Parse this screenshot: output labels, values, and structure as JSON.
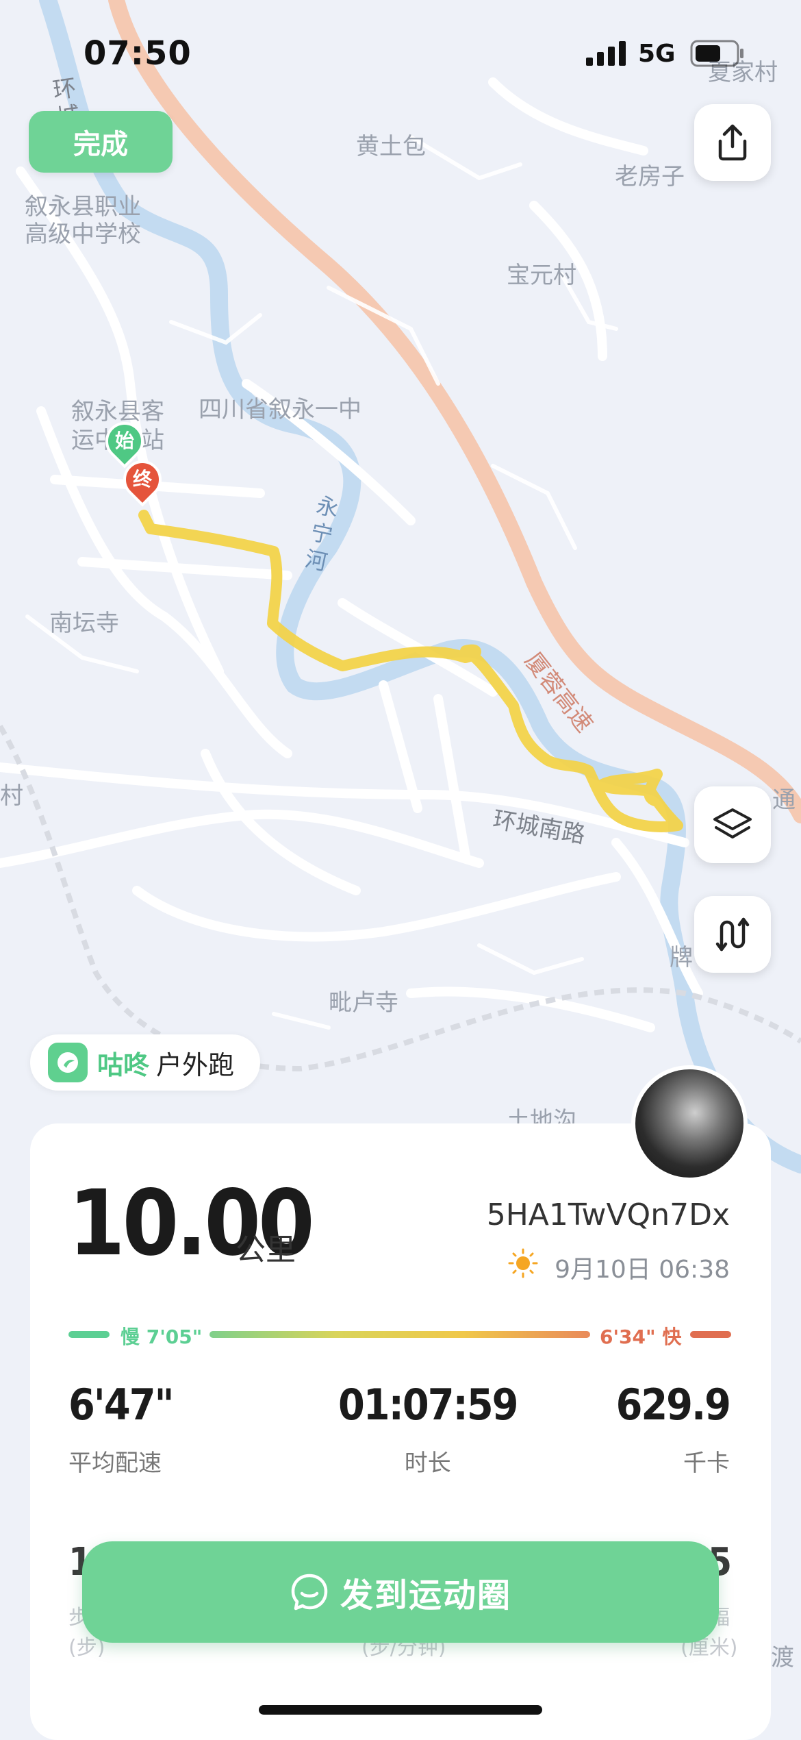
{
  "status_bar": {
    "time": "07:50",
    "network": "5G"
  },
  "top": {
    "done_label": "完成"
  },
  "map": {
    "labels": {
      "xiajiacun": "夏家村",
      "huangtubao": "黄土包",
      "laofangzi": "老房子",
      "baoyuancun": "宝元村",
      "vocational_school": "叙永县职业\n高级中学校",
      "no1_middle_school": "四川省叙永一中",
      "bus_station": "叙永县客\n运中心站",
      "yongning_river": "永宁河",
      "nantansi": "南坛寺",
      "xiarong_expressway": "厦蓉高速",
      "huancheng_south_road": "环城南路",
      "pilusi": "毗卢寺",
      "tudigou": "土地沟",
      "huan_road": "环城",
      "pai": "牌",
      "du": "渡",
      "cun": "村",
      "tong": "通"
    },
    "start_marker": "始",
    "end_marker": "终",
    "route_color": "#f2d34a"
  },
  "brand": {
    "name": "咕咚",
    "activity": "户外跑"
  },
  "summary": {
    "distance": "10.00",
    "distance_unit": "公里",
    "user_id": "5HA1TwVQn7Dx",
    "datetime": "9月10日 06:38",
    "weather_icon": "sun-icon",
    "pace_slow": "慢 7'05\"",
    "pace_fast": "6'34\" 快"
  },
  "stats": [
    {
      "value": "6'47\"",
      "label": "平均配速"
    },
    {
      "value": "01:07:59",
      "label": "时长"
    },
    {
      "value": "629.9",
      "label": "千卡"
    }
  ],
  "partial_stats": {
    "left_value": "11",
    "left_label": "步",
    "left_unit": "(步)",
    "mid_unit": "(步/分钟)",
    "right_value": "5",
    "right_label": "幅",
    "right_unit": "(厘米)"
  },
  "cta": {
    "label": "发到运动圈"
  },
  "colors": {
    "accent": "#6fd396",
    "slow": "#5ccf93",
    "fast": "#e06e50"
  }
}
